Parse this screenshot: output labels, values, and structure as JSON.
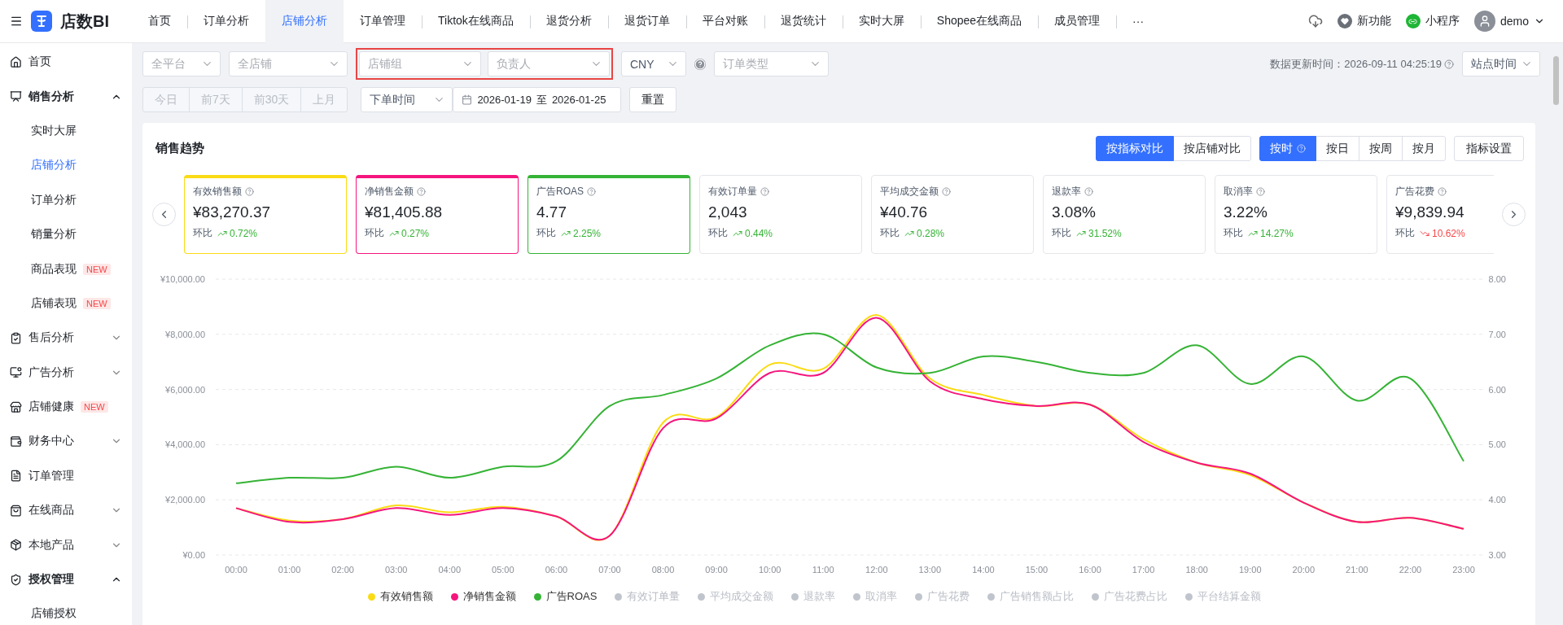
{
  "app": {
    "logo_text": "店数BI"
  },
  "nav_tabs": [
    {
      "label": "首页",
      "selected": false
    },
    {
      "label": "订单分析",
      "selected": false
    },
    {
      "label": "店铺分析",
      "selected": true
    },
    {
      "label": "订单管理",
      "selected": false
    },
    {
      "label": "Tiktok在线商品",
      "selected": false
    },
    {
      "label": "退货分析",
      "selected": false
    },
    {
      "label": "退货订单",
      "selected": false
    },
    {
      "label": "平台对账",
      "selected": false
    },
    {
      "label": "退货统计",
      "selected": false
    },
    {
      "label": "实时大屏",
      "selected": false
    },
    {
      "label": "Shopee在线商品",
      "selected": false
    },
    {
      "label": "成员管理",
      "selected": false
    }
  ],
  "nav_more": "···",
  "header_links": [
    {
      "label": "新功能",
      "kind": "news"
    },
    {
      "label": "小程序",
      "kind": "mini"
    }
  ],
  "user": {
    "name": "demo"
  },
  "sidebar": {
    "items": [
      {
        "label": "首页",
        "selected": false
      },
      {
        "label": "销售分析",
        "selected": false,
        "expanded": true,
        "children": [
          {
            "label": "实时大屏",
            "selected": false
          },
          {
            "label": "店铺分析",
            "selected": true
          },
          {
            "label": "订单分析",
            "selected": false
          },
          {
            "label": "销量分析",
            "selected": false
          },
          {
            "label": "商品表现",
            "selected": false,
            "badge": "NEW"
          },
          {
            "label": "店铺表现",
            "selected": false,
            "badge": "NEW"
          }
        ]
      },
      {
        "label": "售后分析",
        "selected": false,
        "expanded": false
      },
      {
        "label": "广告分析",
        "selected": false,
        "expanded": false
      },
      {
        "label": "店铺健康",
        "selected": false,
        "badge": "NEW"
      },
      {
        "label": "财务中心",
        "selected": false,
        "expanded": false
      },
      {
        "label": "订单管理",
        "selected": false
      },
      {
        "label": "在线商品",
        "selected": false,
        "expanded": false
      },
      {
        "label": "本地产品",
        "selected": false,
        "expanded": false
      },
      {
        "label": "授权管理",
        "selected": false,
        "expanded": true,
        "children": [
          {
            "label": "店铺授权",
            "selected": false
          }
        ]
      }
    ]
  },
  "filters": {
    "platform": {
      "placeholder": "全平台"
    },
    "shop": {
      "placeholder": "全店铺"
    },
    "highlighted": [
      {
        "placeholder": "店铺组"
      },
      {
        "placeholder": "负责人"
      }
    ],
    "currency": {
      "value": "CNY"
    },
    "order_type": {
      "placeholder": "订单类型"
    },
    "update_time": "数据更新时间：2026-09-11 04:25:19",
    "timezone": {
      "value": "站点时间"
    },
    "quick_ranges": [
      {
        "label": "今日",
        "disabled": true
      },
      {
        "label": "前7天",
        "disabled": true
      },
      {
        "label": "前30天",
        "disabled": true
      },
      {
        "label": "上月",
        "disabled": true
      }
    ],
    "date_type": {
      "value": "下单时间"
    },
    "date_range": {
      "start": "2026-01-19",
      "separator": "至",
      "end": "2026-01-25"
    },
    "reset": "重置"
  },
  "card": {
    "title": "销售趋势",
    "compare_modes": [
      {
        "label": "按指标对比",
        "selected": true
      },
      {
        "label": "按店铺对比",
        "selected": false
      }
    ],
    "granularity": [
      {
        "label": "按时",
        "selected": true
      },
      {
        "label": "按日",
        "selected": false
      },
      {
        "label": "按周",
        "selected": false
      },
      {
        "label": "按月",
        "selected": false
      }
    ],
    "settings": "指标设置",
    "metrics": [
      {
        "label": "有效销售额",
        "value": "¥83,270.37",
        "change_label": "环比",
        "change": "0.72%",
        "kind": "up",
        "selected": true,
        "color": "#fadb14"
      },
      {
        "label": "净销售金额",
        "value": "¥81,405.88",
        "change_label": "环比",
        "change": "0.27%",
        "kind": "up",
        "selected": true,
        "color": "#f5157d"
      },
      {
        "label": "广告ROAS",
        "value": "4.77",
        "change_label": "环比",
        "change": "2.25%",
        "kind": "up",
        "selected": true,
        "color": "#35b335"
      },
      {
        "label": "有效订单量",
        "value": "2,043",
        "change_label": "环比",
        "change": "0.44%",
        "kind": "up",
        "selected": false
      },
      {
        "label": "平均成交金额",
        "value": "¥40.76",
        "change_label": "环比",
        "change": "0.28%",
        "kind": "up",
        "selected": false
      },
      {
        "label": "退款率",
        "value": "3.08%",
        "change_label": "环比",
        "change": "31.52%",
        "kind": "up",
        "selected": false
      },
      {
        "label": "取消率",
        "value": "3.22%",
        "change_label": "环比",
        "change": "14.27%",
        "kind": "up",
        "selected": false
      },
      {
        "label": "广告花费",
        "value": "¥9,839.94",
        "change_label": "环比",
        "change": "10.62%",
        "kind": "down",
        "selected": false
      }
    ],
    "chart_data": {
      "type": "line",
      "x": [
        "00:00",
        "01:00",
        "02:00",
        "03:00",
        "04:00",
        "05:00",
        "06:00",
        "07:00",
        "08:00",
        "09:00",
        "10:00",
        "11:00",
        "12:00",
        "13:00",
        "14:00",
        "15:00",
        "16:00",
        "17:00",
        "18:00",
        "19:00",
        "20:00",
        "21:00",
        "22:00",
        "23:00"
      ],
      "ylim": [
        0,
        10000
      ],
      "yticks": [
        {
          "value": 0,
          "label": "¥0.00"
        },
        {
          "value": 2000,
          "label": "¥2,000.00"
        },
        {
          "value": 4000,
          "label": "¥4,000.00"
        },
        {
          "value": 6000,
          "label": "¥6,000.00"
        },
        {
          "value": 8000,
          "label": "¥8,000.00"
        },
        {
          "value": 10000,
          "label": "¥10,000.00"
        }
      ],
      "grid": true,
      "y2lim": [
        3,
        8
      ],
      "y2ticks": [
        {
          "value": 3,
          "label": "3.00"
        },
        {
          "value": 4,
          "label": "4.00"
        },
        {
          "value": 5,
          "label": "5.00"
        },
        {
          "value": 6,
          "label": "6.00"
        },
        {
          "value": 7,
          "label": "7.00"
        },
        {
          "value": 8,
          "label": "8.00"
        }
      ],
      "series": [
        {
          "name": "有效销售额",
          "color": "#fadb14",
          "values": [
            1700,
            1250,
            1300,
            1800,
            1550,
            1750,
            1400,
            700,
            4800,
            5000,
            6900,
            6750,
            8700,
            6400,
            5800,
            5400,
            5450,
            4200,
            3350,
            2900,
            1900,
            1200,
            1350,
            950
          ]
        },
        {
          "name": "净销售金额",
          "color": "#f5157d",
          "values": [
            1700,
            1200,
            1300,
            1700,
            1450,
            1700,
            1400,
            700,
            4600,
            4950,
            6600,
            6600,
            8600,
            6300,
            5650,
            5400,
            5450,
            4100,
            3350,
            2950,
            1900,
            1200,
            1350,
            950
          ]
        },
        {
          "name": "广告ROAS",
          "color": "#35b335",
          "axis": "y2",
          "values": [
            4.3,
            4.4,
            4.4,
            4.6,
            4.4,
            4.6,
            4.7,
            5.7,
            5.9,
            6.2,
            6.8,
            7.0,
            6.4,
            6.3,
            6.6,
            6.5,
            6.3,
            6.3,
            6.8,
            6.1,
            6.6,
            5.8,
            6.2,
            4.7
          ]
        }
      ]
    },
    "legend_more": [
      {
        "label": "有效订单量",
        "selected": false
      },
      {
        "label": "平均成交金额",
        "selected": false
      },
      {
        "label": "退款率",
        "selected": false
      },
      {
        "label": "取消率",
        "selected": false
      },
      {
        "label": "广告花费",
        "selected": false
      },
      {
        "label": "广告销售额占比",
        "selected": false
      },
      {
        "label": "广告花费占比",
        "selected": false
      },
      {
        "label": "平台结算金额",
        "selected": false
      }
    ]
  }
}
